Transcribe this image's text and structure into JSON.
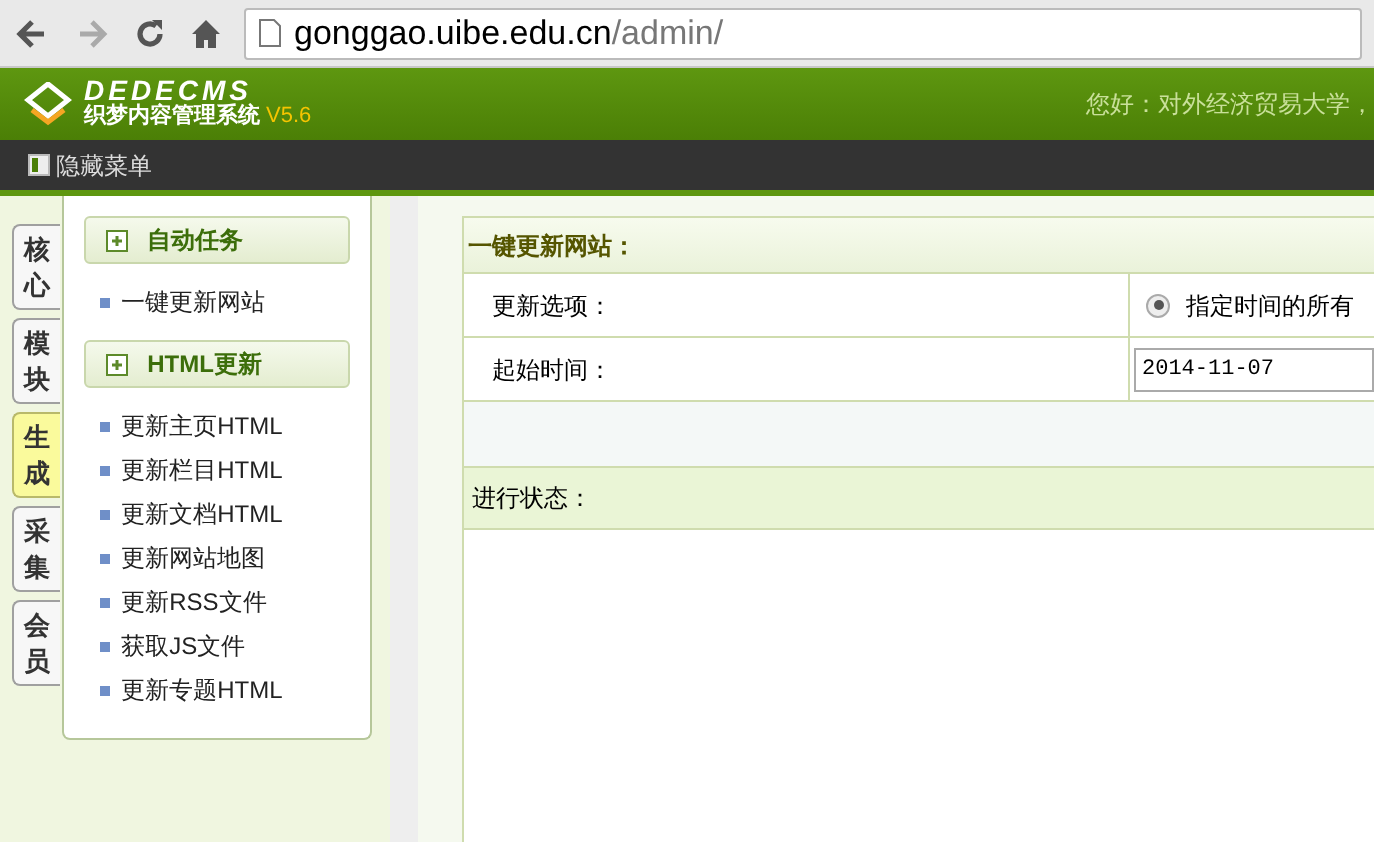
{
  "browser": {
    "url_host": "gonggao.uibe.edu.cn",
    "url_path": "/admin/"
  },
  "header": {
    "logo": "DEDECMS",
    "subtitle": "织梦内容管理系统",
    "version": "V5.6",
    "greeting": "您好：对外经济贸易大学，"
  },
  "toolbar": {
    "toggle_label": "隐藏菜单"
  },
  "side_tabs": [
    {
      "label": "核心",
      "selected": false
    },
    {
      "label": "模块",
      "selected": false
    },
    {
      "label": "生成",
      "selected": true
    },
    {
      "label": "采集",
      "selected": false
    },
    {
      "label": "会员",
      "selected": false
    }
  ],
  "menu_sections": [
    {
      "title": "自动任务",
      "items": [
        "一键更新网站"
      ]
    },
    {
      "title": "HTML更新",
      "items": [
        "更新主页HTML",
        "更新栏目HTML",
        "更新文档HTML",
        "更新网站地图",
        "更新RSS文件",
        "获取JS文件",
        "更新专题HTML"
      ]
    }
  ],
  "form": {
    "title": "一键更新网站：",
    "rows": [
      {
        "kind": "radio",
        "label": "更新选项：",
        "option": "指定时间的所有",
        "selected": true
      },
      {
        "kind": "date",
        "label": "起始时间：",
        "value": "2014-11-07"
      }
    ],
    "status_title": "进行状态："
  }
}
